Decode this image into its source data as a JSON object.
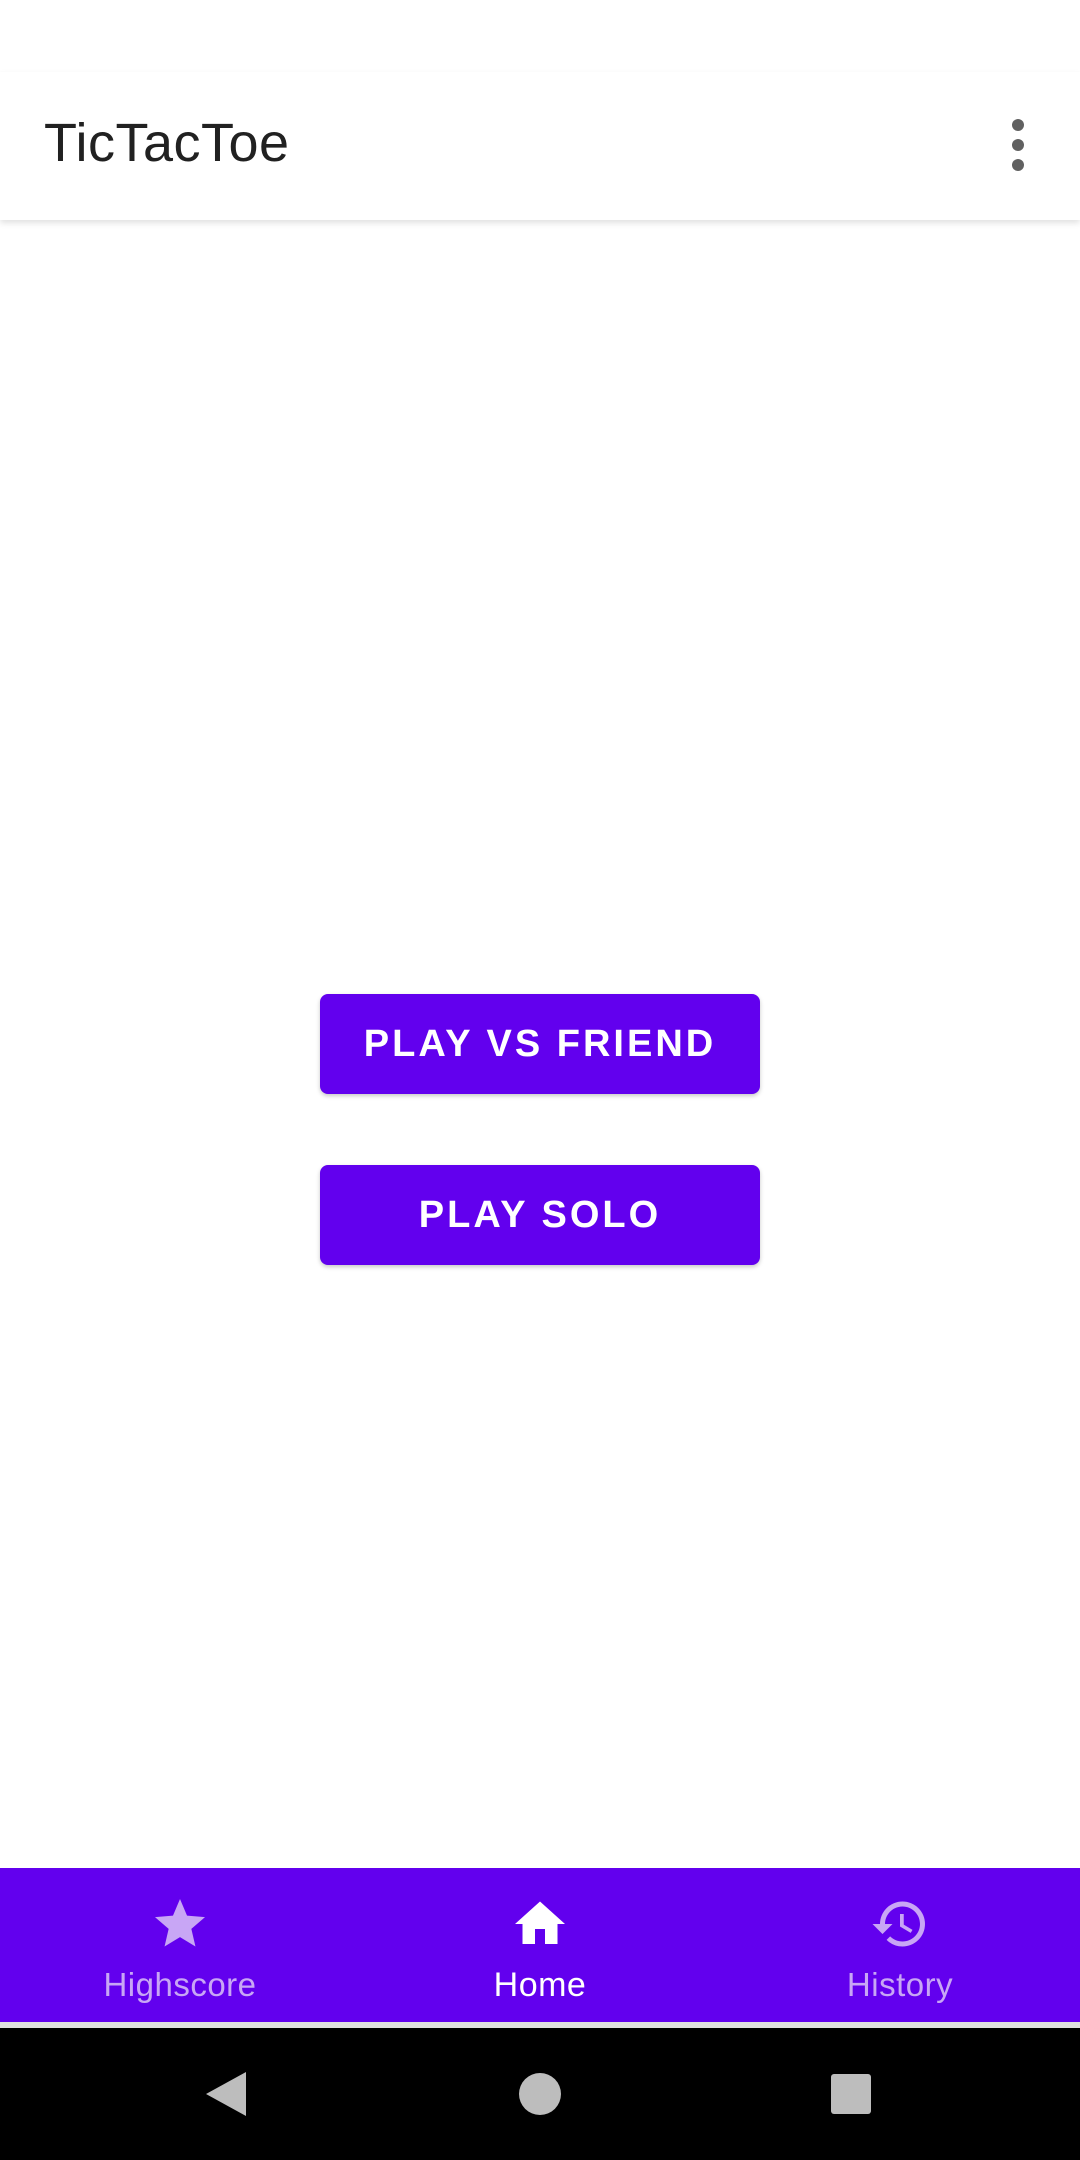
{
  "app_bar": {
    "title": "TicTacToe",
    "menu_icon": "more-vert-icon"
  },
  "main": {
    "buttons": [
      {
        "label": "PLAY VS FRIEND"
      },
      {
        "label": "PLAY SOLO"
      }
    ]
  },
  "bottom_nav": {
    "items": [
      {
        "label": "Highscore",
        "icon": "star-icon",
        "active": false
      },
      {
        "label": "Home",
        "icon": "home-icon",
        "active": true
      },
      {
        "label": "History",
        "icon": "history-icon",
        "active": false
      }
    ]
  },
  "system_nav": {
    "back_icon": "back-triangle-icon",
    "home_icon": "home-circle-icon",
    "recents_icon": "recents-square-icon"
  },
  "colors": {
    "primary": "#6200ee",
    "on_primary": "#ffffff",
    "inactive_nav": "#c8a6f5",
    "title_text": "#212121"
  }
}
